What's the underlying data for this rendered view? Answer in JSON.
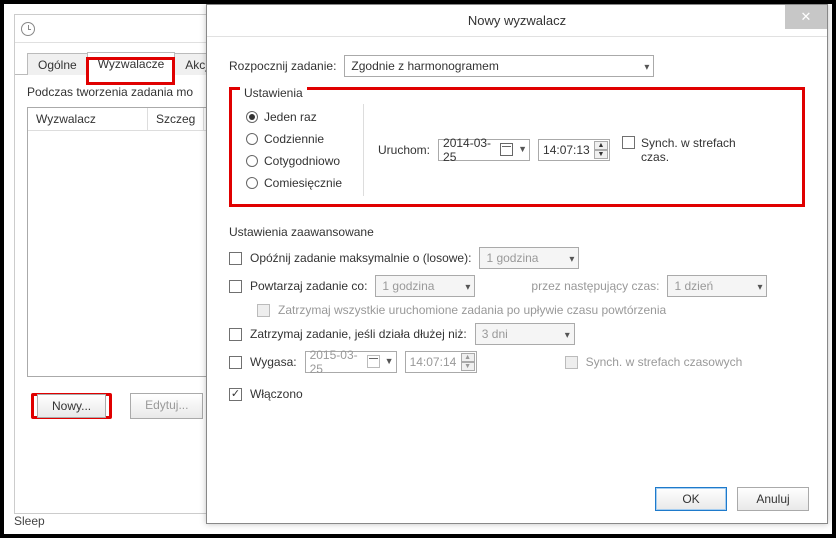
{
  "back_window": {
    "tabs": {
      "general": "Ogólne",
      "triggers": "Wyzwalacze",
      "actions": "Akcje"
    },
    "desc": "Podczas tworzenia zadania mo",
    "list": {
      "col1": "Wyzwalacz",
      "col2": "Szczeg"
    },
    "buttons": {
      "new": "Nowy...",
      "edit": "Edytuj..."
    }
  },
  "dialog": {
    "title": "Nowy wyzwalacz",
    "begin_label": "Rozpocznij zadanie:",
    "begin_value": "Zgodnie z harmonogramem",
    "settings_legend": "Ustawienia",
    "radios": {
      "once": "Jeden raz",
      "daily": "Codziennie",
      "weekly": "Cotygodniowo",
      "monthly": "Comiesięcznie"
    },
    "launch_label": "Uruchom:",
    "launch_date": "2014-03-25",
    "launch_time": "14:07:13",
    "sync_tz1": "Synch. w strefach",
    "sync_tz2": "czas.",
    "adv_legend": "Ustawienia zaawansowane",
    "delay_label": "Opóźnij zadanie maksymalnie o (losowe):",
    "delay_value": "1 godzina",
    "repeat_label": "Powtarzaj zadanie co:",
    "repeat_value": "1 godzina",
    "repeat_for_label": "przez następujący czas:",
    "repeat_for_value": "1 dzień",
    "stop_all_label": "Zatrzymaj wszystkie uruchomione zadania po upływie czasu powtórzenia",
    "stop_if_label": "Zatrzymaj zadanie, jeśli działa dłużej niż:",
    "stop_if_value": "3 dni",
    "expire_label": "Wygasa:",
    "expire_date": "2015-03-25",
    "expire_time": "14:07:14",
    "sync_tz_full": "Synch. w strefach czasowych",
    "enabled_label": "Włączono",
    "ok": "OK",
    "cancel": "Anuluj"
  },
  "footer_text": "Sleep"
}
